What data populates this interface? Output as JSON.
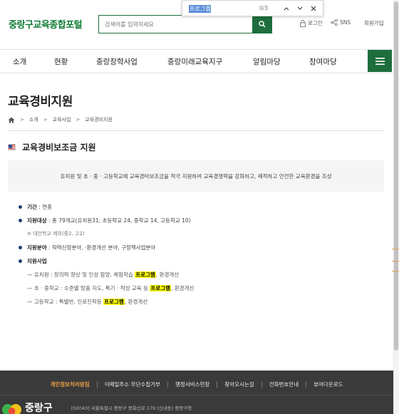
{
  "header": {
    "logo": "중랑구교육종합포털",
    "search_placeholder": "검색어를 입력하세요",
    "login": "로그인",
    "sns": "SNS",
    "signup": "회원가입"
  },
  "find_bar": {
    "query": "프로그램",
    "count": "0/3"
  },
  "nav": {
    "items": [
      "소개",
      "현황",
      "중랑장학사업",
      "중랑미래교육지구",
      "알림마당",
      "참여마당"
    ]
  },
  "page": {
    "title": "교육경비지원",
    "breadcrumb": [
      "소개",
      "교육사업",
      "교육경비지원"
    ],
    "section_title": "교육경비보조금 지원",
    "intro": "유치원 및 초 · 중 · 고등학교에 교육경비보조금을 적극 지원하여 교육경쟁력을 강화하고, 쾌적하고 안전한 교육환경을 조성"
  },
  "details": {
    "period_label": "기간",
    "period_value": " : 연중",
    "target_label": "지원대상",
    "target_value": " : 총 79개교(유치원31, 초등학교 24, 중학교 14, 고등학교 10)",
    "target_note": "※ 대안학교 제외(중2, 고2)",
    "field_label": "지원분야",
    "field_value": " : 학력신장분야, ·환경개선 분야, 구정책사업분야",
    "project_label": "지원사업",
    "kinder_prefix": "유치원 : 창의력 향상 및 인성 함양, 체험학습 ",
    "kinder_hl": "프로그램",
    "kinder_suffix": ", 환경개선",
    "elem_prefix": "초 · 중학교 : 수준별 맞춤 지도, 특기 · 적성 교육 등 ",
    "elem_hl": "프로그램",
    "elem_suffix": ", 환경개선",
    "high_prefix": "고등학교 : 특별반, 진로진학등 ",
    "high_hl": "프로그램",
    "high_suffix": ", 환경개선"
  },
  "footer": {
    "links": [
      "개인정보처리방침",
      "이메일주소 무단수집거부",
      "행정서비스헌장",
      "찾아오시는길",
      "전화번호안내",
      "뷰어다운로드"
    ],
    "logo": "중랑구",
    "address": "[02043] 서울특별시 중랑구 봉화산로 179 (신내동) 중랑구청"
  },
  "colors": {
    "brand_green": "#1d6e3c",
    "highlight": "#ffff00",
    "footer_bg": "#3a3a3a",
    "privacy": "#f0a142"
  }
}
